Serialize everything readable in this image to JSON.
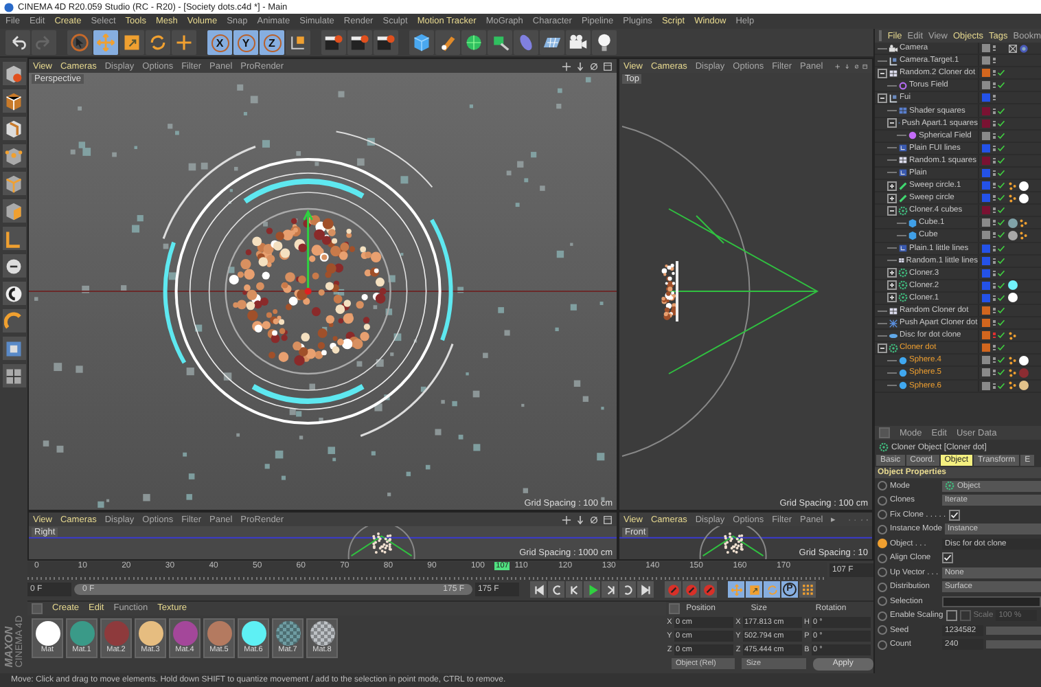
{
  "window": {
    "title": "CINEMA 4D R20.059 Studio (RC - R20) - [Society dots.c4d *] - Main"
  },
  "menu": [
    {
      "label": "File",
      "highlighted": false
    },
    {
      "label": "Edit",
      "highlighted": false
    },
    {
      "label": "Create",
      "highlighted": true
    },
    {
      "label": "Select",
      "highlighted": false
    },
    {
      "label": "Tools",
      "highlighted": true
    },
    {
      "label": "Mesh",
      "highlighted": true
    },
    {
      "label": "Volume",
      "highlighted": true
    },
    {
      "label": "Snap",
      "highlighted": false
    },
    {
      "label": "Animate",
      "highlighted": false
    },
    {
      "label": "Simulate",
      "highlighted": false
    },
    {
      "label": "Render",
      "highlighted": false
    },
    {
      "label": "Sculpt",
      "highlighted": false
    },
    {
      "label": "Motion Tracker",
      "highlighted": true
    },
    {
      "label": "MoGraph",
      "highlighted": false
    },
    {
      "label": "Character",
      "highlighted": false
    },
    {
      "label": "Pipeline",
      "highlighted": false
    },
    {
      "label": "Plugins",
      "highlighted": false
    },
    {
      "label": "Script",
      "highlighted": true
    },
    {
      "label": "Window",
      "highlighted": true
    },
    {
      "label": "Help",
      "highlighted": false
    }
  ],
  "toolbar": [
    {
      "kind": "undo",
      "selected": false
    },
    {
      "kind": "redo",
      "selected": false
    },
    {
      "kind": "select",
      "selected": false
    },
    {
      "kind": "move",
      "selected": true
    },
    {
      "kind": "scale",
      "selected": false
    },
    {
      "kind": "rotate",
      "selected": false
    },
    {
      "kind": "add",
      "selected": false
    },
    {
      "kind": "axis",
      "label": "X",
      "selected": true
    },
    {
      "kind": "axis",
      "label": "Y",
      "selected": true
    },
    {
      "kind": "axis",
      "label": "Z",
      "selected": true
    },
    {
      "kind": "coord",
      "selected": false
    },
    {
      "kind": "render",
      "selected": false
    },
    {
      "kind": "render",
      "selected": false
    },
    {
      "kind": "render",
      "selected": false
    },
    {
      "kind": "cube",
      "selected": false
    },
    {
      "kind": "pen",
      "selected": false
    },
    {
      "kind": "subdiv",
      "selected": false
    },
    {
      "kind": "generator",
      "selected": false
    },
    {
      "kind": "deformer",
      "selected": false
    },
    {
      "kind": "floor",
      "selected": false
    },
    {
      "kind": "camera",
      "selected": false
    },
    {
      "kind": "light",
      "selected": false
    }
  ],
  "viewports": [
    {
      "kind": "perspective",
      "label": "Perspective",
      "menu": [
        {
          "label": "View",
          "highlighted": true
        },
        {
          "label": "Cameras",
          "highlighted": true
        },
        {
          "label": "Display",
          "highlighted": false
        },
        {
          "label": "Options",
          "highlighted": false
        },
        {
          "label": "Filter",
          "highlighted": false
        },
        {
          "label": "Panel",
          "highlighted": false
        },
        {
          "label": "ProRender",
          "highlighted": false
        }
      ],
      "grid_spacing": "Grid Spacing : 100 cm"
    },
    {
      "kind": "top",
      "label": "Top",
      "menu": [
        {
          "label": "View",
          "highlighted": true
        },
        {
          "label": "Cameras",
          "highlighted": true
        },
        {
          "label": "Display",
          "highlighted": false
        },
        {
          "label": "Options",
          "highlighted": false
        },
        {
          "label": "Filter",
          "highlighted": false
        },
        {
          "label": "Panel",
          "highlighted": false
        }
      ],
      "grid_spacing": "Grid Spacing : 100 cm"
    },
    {
      "kind": "right",
      "label": "Right",
      "menu": [
        {
          "label": "View",
          "highlighted": true
        },
        {
          "label": "Cameras",
          "highlighted": true
        },
        {
          "label": "Display",
          "highlighted": false
        },
        {
          "label": "Options",
          "highlighted": false
        },
        {
          "label": "Filter",
          "highlighted": false
        },
        {
          "label": "Panel",
          "highlighted": false
        },
        {
          "label": "ProRender",
          "highlighted": false
        }
      ],
      "grid_spacing": "Grid Spacing : 1000 cm"
    },
    {
      "kind": "front",
      "label": "Front",
      "menu": [
        {
          "label": "View",
          "highlighted": true
        },
        {
          "label": "Cameras",
          "highlighted": true
        },
        {
          "label": "Display",
          "highlighted": false
        },
        {
          "label": "Options",
          "highlighted": false
        },
        {
          "label": "Filter",
          "highlighted": false
        },
        {
          "label": "Panel",
          "highlighted": false
        },
        {
          "label": "▸",
          "highlighted": false
        }
      ],
      "grid_spacing": "Grid Spacing : 10"
    }
  ],
  "timeline": {
    "ticks": [
      "0",
      "10",
      "20",
      "30",
      "40",
      "50",
      "60",
      "70",
      "80",
      "90",
      "100",
      "110",
      "120",
      "130",
      "140",
      "150",
      "160",
      "170"
    ],
    "current": {
      "label": "107",
      "level": 0.601
    },
    "current_field": "107 F",
    "start_field": "0 F",
    "range_bar": {
      "start": "0 F",
      "end": "175 F",
      "level": 1
    },
    "end_field": "175 F",
    "mode_buttons": [
      {
        "kind": "move",
        "selected": true
      },
      {
        "kind": "scale",
        "selected": true
      },
      {
        "kind": "rotate",
        "selected": true
      },
      {
        "kind": "param",
        "label": "P",
        "selected": true
      },
      {
        "kind": "grid",
        "selected": false
      }
    ]
  },
  "materials": {
    "menu": [
      {
        "label": "Create",
        "highlighted": true
      },
      {
        "label": "Edit",
        "highlighted": true
      },
      {
        "label": "Function",
        "highlighted": false
      },
      {
        "label": "Texture",
        "highlighted": true
      }
    ],
    "items": [
      {
        "name": "Mat",
        "color": "#ffffff",
        "transparent": false
      },
      {
        "name": "Mat.1",
        "color": "#3a9a88",
        "transparent": false
      },
      {
        "name": "Mat.2",
        "color": "#8e3a3c",
        "transparent": false
      },
      {
        "name": "Mat.3",
        "color": "#e6bd80",
        "transparent": false
      },
      {
        "name": "Mat.4",
        "color": "#a4479a",
        "transparent": false
      },
      {
        "name": "Mat.5",
        "color": "#b47a60",
        "transparent": false
      },
      {
        "name": "Mat.6",
        "color": "#5ef0f4",
        "transparent": false
      },
      {
        "name": "Mat.7",
        "color": "#6e9ca2",
        "transparent": true
      },
      {
        "name": "Mat.8",
        "color": "#bcc0c4",
        "transparent": true
      }
    ]
  },
  "coordinates": {
    "headers": [
      "Position",
      "Size",
      "Rotation"
    ],
    "rows": [
      {
        "axis": "X",
        "position": "0 cm",
        "size_axis": "X",
        "size": "177.813 cm",
        "rotation_axis": "H",
        "rotation": "0 °"
      },
      {
        "axis": "Y",
        "position": "0 cm",
        "size_axis": "Y",
        "size": "502.794 cm",
        "rotation_axis": "P",
        "rotation": "0 °"
      },
      {
        "axis": "Z",
        "position": "0 cm",
        "size_axis": "Z",
        "size": "475.444 cm",
        "rotation_axis": "B",
        "rotation": "0 °"
      }
    ],
    "space": "Object (Rel)",
    "size_mode": "Size",
    "apply": "Apply"
  },
  "logo": {
    "brand": "MAXON",
    "product": "CINEMA 4D"
  },
  "object_manager": {
    "menu": [
      {
        "label": "File",
        "highlighted": true
      },
      {
        "label": "Edit",
        "highlighted": false
      },
      {
        "label": "View",
        "highlighted": false
      },
      {
        "label": "Objects",
        "highlighted": true
      },
      {
        "label": "Tags",
        "highlighted": true
      },
      {
        "label": "Bookm",
        "highlighted": false
      }
    ],
    "objects": [
      {
        "name": "Camera",
        "kind": "camera",
        "color": "#8a8a8a",
        "selected": false,
        "tags": [
          {
            "kind": "protection"
          },
          {
            "kind": "target"
          }
        ]
      },
      {
        "name": "Camera.Target.1",
        "kind": "target",
        "color": "#8a8a8a",
        "selected": false
      },
      {
        "name": "Random.2 Cloner dot",
        "kind": "random",
        "color": "#d2661e",
        "enabled": true,
        "selected": false,
        "expanded": true,
        "children": [
          {
            "name": "Torus Field",
            "kind": "torus-field",
            "color": "#8a8a8a",
            "enabled": true,
            "selected": false
          }
        ]
      },
      {
        "name": "Fui",
        "kind": "null",
        "color": "#2452e8",
        "selected": false,
        "expanded": true,
        "children": [
          {
            "name": "Shader squares",
            "kind": "shader",
            "color": "#7a1232",
            "enabled": true,
            "selected": false
          },
          {
            "name": "Push Apart.1 squares",
            "kind": "push-apart",
            "color": "#7a1232",
            "enabled": true,
            "selected": false,
            "expanded": true,
            "children": [
              {
                "name": "Spherical Field",
                "kind": "sphere-field",
                "color": "#8a8a8a",
                "enabled": true,
                "selected": false
              }
            ]
          },
          {
            "name": "Plain FUI lines",
            "kind": "plain",
            "color": "#2452e8",
            "enabled": true,
            "selected": false
          },
          {
            "name": "Random.1 squares",
            "kind": "random",
            "color": "#7a1232",
            "enabled": true,
            "selected": false
          },
          {
            "name": "Plain",
            "kind": "plain",
            "color": "#2452e8",
            "enabled": true,
            "selected": false
          },
          {
            "name": "Sweep circle.1",
            "kind": "sweep",
            "color": "#2452e8",
            "enabled": true,
            "selected": false,
            "expanded": false,
            "tags": [
              {
                "kind": "phong"
              },
              {
                "kind": "material",
                "color": "#ffffff"
              }
            ]
          },
          {
            "name": "Sweep circle",
            "kind": "sweep",
            "color": "#2452e8",
            "enabled": true,
            "selected": false,
            "expanded": false,
            "tags": [
              {
                "kind": "phong"
              },
              {
                "kind": "material",
                "color": "#ffffff"
              }
            ]
          },
          {
            "name": "Cloner.4 cubes",
            "kind": "cloner",
            "color": "#7a1232",
            "enabled": true,
            "selected": false,
            "expanded": true,
            "children": [
              {
                "name": "Cube.1",
                "kind": "cube",
                "color": "#8a8a8a",
                "enabled": true,
                "selected": false,
                "tags": [
                  {
                    "kind": "material",
                    "color": "#7fa2a8"
                  },
                  {
                    "kind": "phong"
                  }
                ]
              },
              {
                "name": "Cube",
                "kind": "cube",
                "color": "#8a8a8a",
                "enabled": true,
                "selected": false,
                "tags": [
                  {
                    "kind": "material",
                    "color": "#a8a8a8"
                  },
                  {
                    "kind": "phong"
                  }
                ]
              }
            ]
          },
          {
            "name": "Plain.1 little lines",
            "kind": "plain",
            "color": "#2452e8",
            "enabled": true,
            "selected": false
          },
          {
            "name": "Random.1 little lines",
            "kind": "random",
            "color": "#2452e8",
            "enabled": true,
            "selected": false
          },
          {
            "name": "Cloner.3",
            "kind": "cloner",
            "color": "#2452e8",
            "enabled": true,
            "selected": false,
            "expanded": false
          },
          {
            "name": "Cloner.2",
            "kind": "cloner",
            "color": "#2452e8",
            "enabled": true,
            "selected": false,
            "expanded": false,
            "tags": [
              {
                "kind": "material",
                "color": "#72f2fa"
              }
            ]
          },
          {
            "name": "Cloner.1",
            "kind": "cloner",
            "color": "#2452e8",
            "enabled": true,
            "selected": false,
            "expanded": false,
            "tags": [
              {
                "kind": "material",
                "color": "#ffffff"
              }
            ]
          }
        ]
      },
      {
        "name": "Random Cloner dot",
        "kind": "random",
        "color": "#d2661e",
        "enabled": true,
        "selected": false
      },
      {
        "name": "Push Apart Cloner dot",
        "kind": "push-apart",
        "color": "#d2661e",
        "enabled": true,
        "selected": false
      },
      {
        "name": "Disc for dot clone",
        "kind": "disc",
        "color": "#d2661e",
        "enabled": true,
        "hidden_in_editor": true,
        "selected": false,
        "tags": [
          {
            "kind": "phong"
          }
        ]
      },
      {
        "name": "Cloner dot",
        "kind": "cloner",
        "color": "#d2661e",
        "enabled": true,
        "selected": true,
        "expanded": true,
        "children": [
          {
            "name": "Sphere.4",
            "kind": "sphere",
            "color": "#8a8a8a",
            "enabled": true,
            "selected": true,
            "tags": [
              {
                "kind": "phong"
              },
              {
                "kind": "material",
                "color": "#ffffff"
              }
            ]
          },
          {
            "name": "Sphere.5",
            "kind": "sphere",
            "color": "#8a8a8a",
            "enabled": true,
            "selected": true,
            "tags": [
              {
                "kind": "phong"
              },
              {
                "kind": "material",
                "color": "#8c2c32"
              }
            ]
          },
          {
            "name": "Sphere.6",
            "kind": "sphere",
            "color": "#8a8a8a",
            "enabled": true,
            "selected": true,
            "tags": [
              {
                "kind": "phong"
              },
              {
                "kind": "material",
                "color": "#e2c28a"
              }
            ]
          }
        ]
      }
    ]
  },
  "attributes": {
    "menu": [
      "Mode",
      "Edit",
      "User Data"
    ],
    "title": "Cloner Object [Cloner dot]",
    "tabs": [
      {
        "label": "Basic",
        "selected": false
      },
      {
        "label": "Coord.",
        "selected": false
      },
      {
        "label": "Object",
        "selected": true
      },
      {
        "label": "Transform",
        "selected": false
      },
      {
        "label": "E",
        "selected": false
      }
    ],
    "section": "Object Properties",
    "rows": [
      {
        "kind": "dropdown",
        "label": "Mode",
        "value": "Object",
        "icon": true
      },
      {
        "kind": "dropdown",
        "label": "Clones",
        "value": "Iterate"
      },
      {
        "kind": "checkbox",
        "label": "Fix Clone . . . . .",
        "checked": true
      },
      {
        "kind": "dropdown",
        "label": "Instance Mode",
        "value": "Instance"
      },
      {
        "kind": "link",
        "label": "Object . . .",
        "value": "Disc for dot clone"
      },
      {
        "kind": "checkbox",
        "label": "Align Clone",
        "checked": true
      },
      {
        "kind": "dropdown",
        "label": "Up Vector . . .",
        "value": "None"
      },
      {
        "kind": "dropdown",
        "label": "Distribution",
        "value": "Surface"
      },
      {
        "kind": "field",
        "label": "Selection"
      },
      {
        "kind": "checkbox",
        "label": "Enable Scaling",
        "checked": false,
        "sub_checked": false,
        "sub_label": "Scale",
        "sub_value": "100 %"
      },
      {
        "kind": "number",
        "label": "Seed",
        "value": "1234582"
      },
      {
        "kind": "number",
        "label": "Count",
        "value": "240"
      }
    ]
  },
  "status_bar": "Move: Click and drag to move elements. Hold down SHIFT to quantize movement / add to the selection in point mode, CTRL to remove."
}
